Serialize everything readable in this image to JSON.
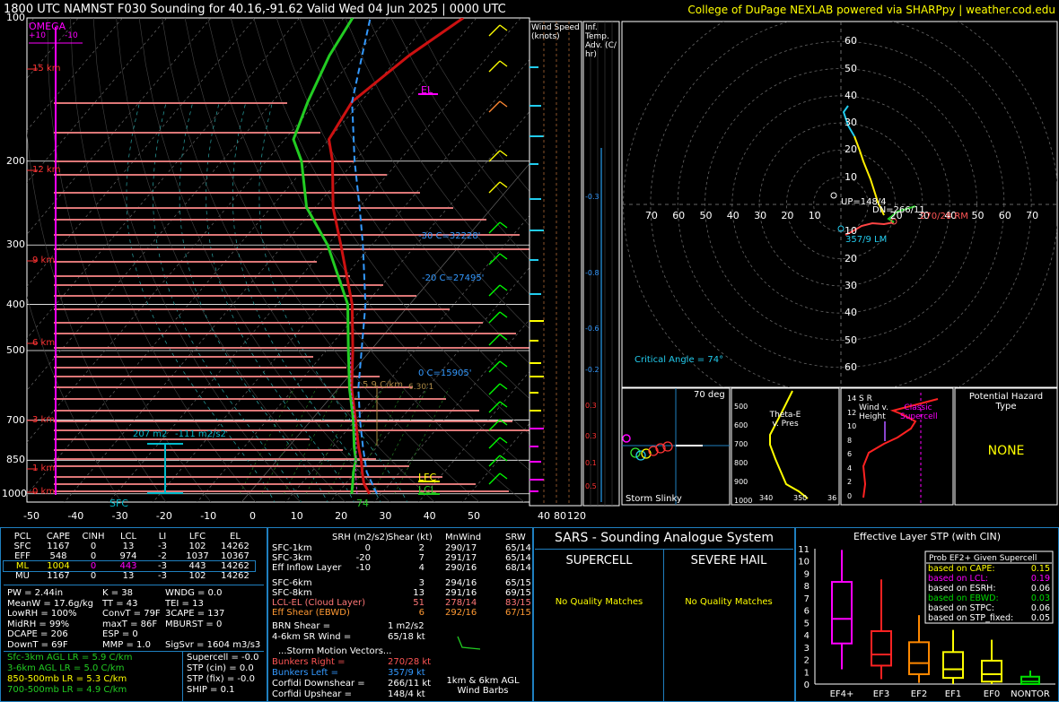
{
  "header": {
    "title": "1800 UTC NAMNST F030 Sounding for 40.16,-91.62 Valid  Wed 04 Jun 2025 | 0000 UTC",
    "credit": "College of DuPage NEXLAB powered via SHARPpy | weather.cod.edu"
  },
  "colors": {
    "temp": "#cc1111",
    "dewpoint": "#22cc22",
    "wetbulb": "#00ffff",
    "parcel": "#ffffff",
    "virt_parcel": "#3399ff",
    "panel_border": "#1f7fbf",
    "yellow": "#ffff00",
    "magenta": "#ff00ff",
    "hodo_cyan": "#22ccee",
    "hodo_yellow": "#ffee00",
    "grid": "#555555"
  },
  "skewt": {
    "pressure_ticks": [
      "100",
      "200",
      "300",
      "400",
      "500",
      "700",
      "850",
      "1000"
    ],
    "temp_ticks": [
      "-50",
      "-40",
      "-30",
      "-20",
      "-10",
      "0",
      "10",
      "20",
      "30",
      "40",
      "50"
    ],
    "height_labels": [
      "15 km",
      "12 km",
      "9 km",
      "6 km",
      "3 km",
      "1 km",
      "0 km"
    ],
    "omega_label": "OMEGA",
    "omega_ticks": [
      "+10",
      "-10"
    ],
    "el_label": "EL",
    "lfc_label": "LFC",
    "lcl_label": "LCL",
    "sfc_label": "SFC",
    "sfc_td": "74",
    "iso_30": "-30 C=32228'",
    "iso_20": "-20 C=27495'",
    "iso_0": "0 C=15905'",
    "lapse_label": "5.9 C/km",
    "lapse_label2": "6.30'1",
    "srh_label": "207 m2",
    "srh_label2": "-111 m2/s2",
    "wind_speed_title": "Wind Speed (knots)",
    "wind_speed_ticks": [
      "40",
      "80",
      "120"
    ],
    "inf_temp_title": "Inf. Temp. Adv. (C/ hr)",
    "inf_temp_ticks": [
      "-0.3",
      "-0.8",
      "-0.6",
      "-0.2",
      "0.3",
      "0.3",
      "0.1",
      "0.5"
    ]
  },
  "hodograph": {
    "ring_labels": [
      "10",
      "20",
      "30",
      "40",
      "50",
      "60"
    ],
    "axis_labels_left": [
      "70",
      "60",
      "50",
      "40",
      "30",
      "20",
      "10"
    ],
    "axis_labels_right": [
      "20",
      "30",
      "40",
      "50",
      "60",
      "70"
    ],
    "up_label": "UP=148/4",
    "dn_label": "DN=266/11",
    "rm_label": "270/28 RM",
    "lm_label": "357/9 LM",
    "critical_angle": "Critical Angle = 74°"
  },
  "slinky": {
    "title": "70 deg",
    "label": "Storm Slinky"
  },
  "theta_e": {
    "title": "Theta-E v. Pres",
    "pres_ticks": [
      "500",
      "600",
      "700",
      "800",
      "900",
      "1000"
    ],
    "x_ticks": [
      "340",
      "350",
      "36"
    ]
  },
  "srwind": {
    "title": "S R Wind v. Height",
    "height_ticks": [
      "14",
      "12",
      "10",
      "8",
      "6",
      "4",
      "2",
      "0"
    ],
    "classic": "Classic Supercell"
  },
  "hazard": {
    "title": "Potential Hazard Type",
    "value": "NONE"
  },
  "parcels": {
    "headers": [
      "PCL",
      "CAPE",
      "CINH",
      "LCL",
      "LI",
      "LFC",
      "EL"
    ],
    "rows": [
      [
        "SFC",
        "1167",
        "0",
        "13",
        "-3",
        "102",
        "14262"
      ],
      [
        "EFF",
        "548",
        "0",
        "974",
        "-2",
        "1037",
        "10367"
      ],
      [
        "ML",
        "1004",
        "0",
        "443",
        "-3",
        "443",
        "14262"
      ],
      [
        "MU",
        "1167",
        "0",
        "13",
        "-3",
        "102",
        "14262"
      ]
    ]
  },
  "thermo_params": [
    [
      "PW = 2.44in",
      "K = 38",
      "WNDG = 0.0"
    ],
    [
      "MeanW = 17.6g/kg",
      "TT = 43",
      "TEI = 13"
    ],
    [
      "LowRH = 100%",
      "ConvT = 79F",
      "3CAPE = 137"
    ],
    [
      "MidRH = 99%",
      "maxT = 86F",
      "MBURST = 0"
    ],
    [
      "DCAPE = 206",
      "ESP = 0",
      ""
    ],
    [
      "DownT = 69F",
      "MMP = 1.0",
      "SigSvr = 1604 m3/s3"
    ]
  ],
  "lapse_rates": [
    "Sfc-3km AGL LR = 5.9 C/km",
    "3-6km AGL LR = 5.0 C/km",
    "850-500mb LR = 5.3 C/km",
    "700-500mb LR = 4.9 C/km"
  ],
  "composites": [
    "Supercell = -0.0",
    "STP (cin) = 0.0",
    "STP (fix) = -0.0",
    "SHIP = 0.1"
  ],
  "kinematics": {
    "headers": [
      "SRH (m2/s2)",
      "Shear (kt)",
      "MnWind",
      "SRW"
    ],
    "rows": [
      [
        "SFC-1km",
        "0",
        "2",
        "290/17",
        "65/14"
      ],
      [
        "SFC-3km",
        "-20",
        "7",
        "291/17",
        "65/14"
      ],
      [
        "Eff Inflow Layer",
        "-10",
        "4",
        "290/16",
        "68/14"
      ],
      [
        "SFC-6km",
        "",
        "3",
        "294/16",
        "65/15"
      ],
      [
        "SFC-8km",
        "",
        "13",
        "291/16",
        "69/15"
      ],
      [
        "LCL-EL (Cloud Layer)",
        "",
        "51",
        "278/14",
        "83/15"
      ],
      [
        "Eff Shear (EBWD)",
        "",
        "6",
        "292/16",
        "67/15"
      ]
    ],
    "brn_shear": [
      "BRN Shear =",
      "1 m2/s2"
    ],
    "sr_wind": [
      "4-6km SR Wind =",
      "65/18 kt"
    ],
    "storm_vectors_title": "...Storm Motion Vectors...",
    "vectors": [
      [
        "Bunkers Right =",
        "270/28 kt"
      ],
      [
        "Bunkers Left =",
        "357/9 kt"
      ],
      [
        "Corfidi Downshear =",
        "266/11 kt"
      ],
      [
        "Corfidi Upshear =",
        "148/4 kt"
      ]
    ],
    "barb_caption": "1km & 6km AGL Wind Barbs"
  },
  "sars": {
    "title": "SARS - Sounding Analogue System",
    "supercell": "SUPERCELL",
    "hail": "SEVERE HAIL",
    "supercell_result": "No Quality Matches",
    "hail_result": "No Quality Matches"
  },
  "chart_data": {
    "type": "box",
    "title": "Effective Layer STP (with CIN)",
    "categories": [
      "EF4+",
      "EF3",
      "EF2",
      "EF1",
      "EF0",
      "NONTOR"
    ],
    "ylim": [
      0,
      11
    ],
    "yticks": [
      "0",
      "1",
      "2",
      "3",
      "4",
      "5",
      "6",
      "7",
      "8",
      "9",
      "10",
      "11"
    ],
    "boxes": [
      {
        "whisker_low": 1.2,
        "q1": 3.3,
        "median": 5.3,
        "q3": 8.3,
        "whisker_high": 10.9
      },
      {
        "whisker_low": 0.4,
        "q1": 1.5,
        "median": 2.4,
        "q3": 4.3,
        "whisker_high": 8.5
      },
      {
        "whisker_low": 0.1,
        "q1": 0.8,
        "median": 1.7,
        "q3": 3.4,
        "whisker_high": 5.6
      },
      {
        "whisker_low": 0.0,
        "q1": 0.5,
        "median": 1.2,
        "q3": 2.6,
        "whisker_high": 4.4
      },
      {
        "whisker_low": 0.0,
        "q1": 0.2,
        "median": 0.8,
        "q3": 1.9,
        "whisker_high": 3.6
      },
      {
        "whisker_low": 0.0,
        "q1": 0.0,
        "median": 0.2,
        "q3": 0.6,
        "whisker_high": 1.1
      }
    ],
    "box_colors": [
      "#ff00ff",
      "#ff2222",
      "#ff8800",
      "#ffff00",
      "#ffff00",
      "#00dd00"
    ],
    "legend": {
      "title": "Prob EF2+ Given Supercell",
      "rows": [
        {
          "label": "based on CAPE:",
          "value": "0.15",
          "color": "#ffff00"
        },
        {
          "label": "based on LCL:",
          "value": "0.19",
          "color": "#ff00ff"
        },
        {
          "label": "based on ESRH:",
          "value": "0.06",
          "color": "#ffffff"
        },
        {
          "label": "based on EBWD:",
          "value": "0.03",
          "color": "#00dd00"
        },
        {
          "label": "based on STPC:",
          "value": "0.06",
          "color": "#ffffff"
        },
        {
          "label": "based on STP_fixed:",
          "value": "0.05",
          "color": "#ffffff"
        }
      ]
    }
  }
}
